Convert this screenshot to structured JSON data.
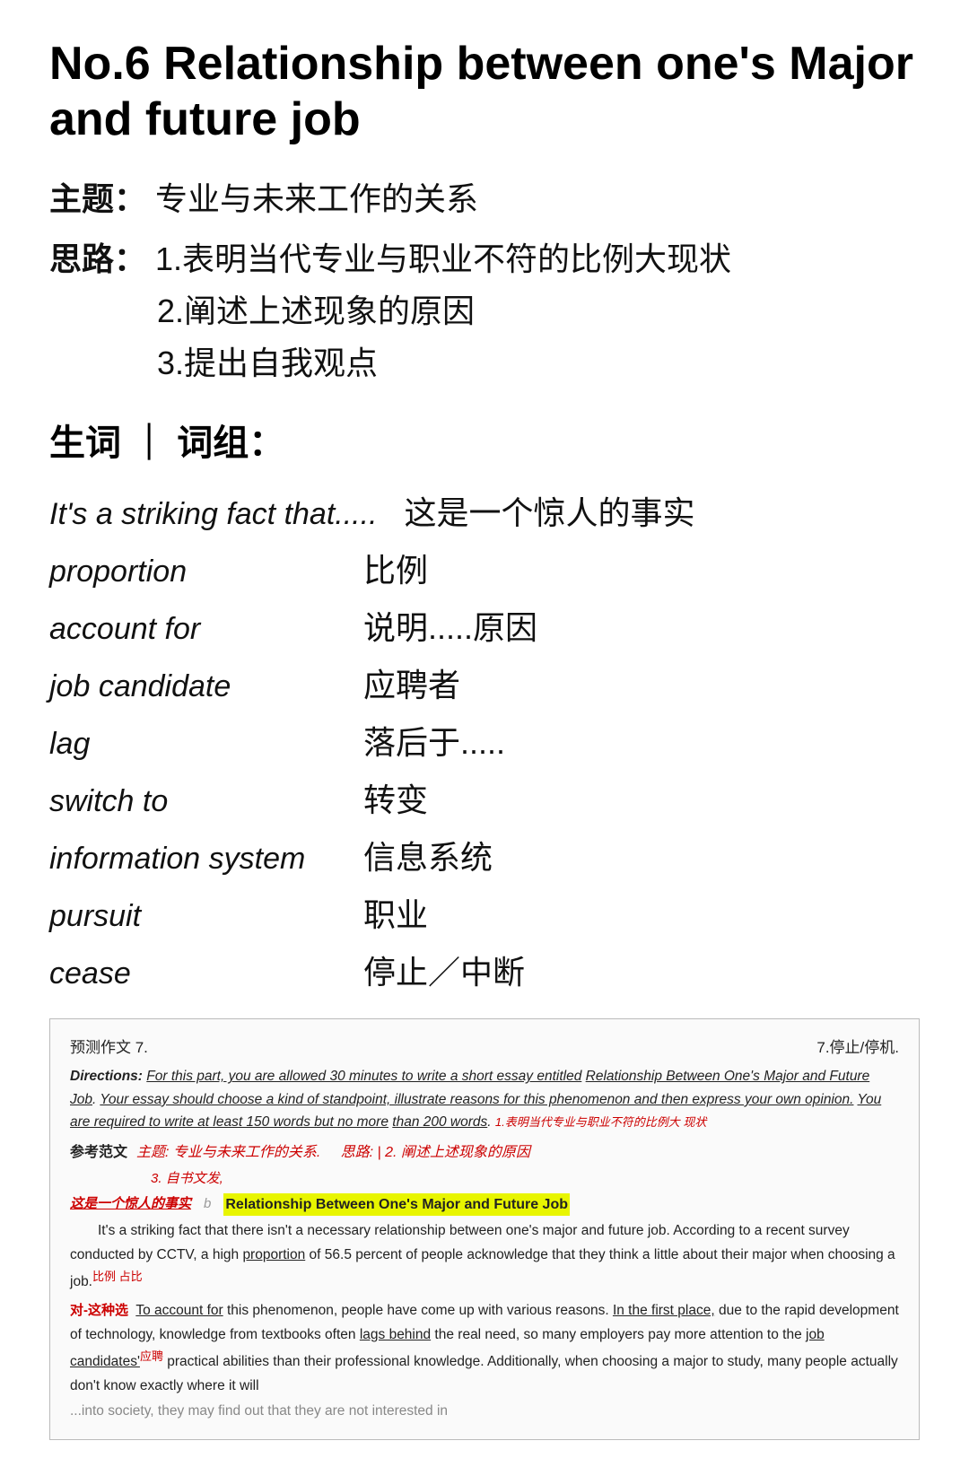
{
  "title": "No.6 Relationship between one's Major and future job",
  "meta": {
    "theme_label": "主题：",
    "theme_text": "专业与未来工作的关系",
    "approach_label": "思路：",
    "approach_items": [
      "1.表明当代专业与职业不符的比例大现状",
      "2.阐述上述现象的原因",
      "3.提出自我观点"
    ]
  },
  "vocab_header": "生词 ｜ 词组：",
  "vocab": [
    {
      "en": "It's a striking fact that.....",
      "zh": "这是一个惊人的事实"
    },
    {
      "en": "proportion",
      "zh": "比例"
    },
    {
      "en": "account for",
      "zh": "说明.....原因"
    },
    {
      "en": "job candidate",
      "zh": "应聘者"
    },
    {
      "en": "lag",
      "zh": "落后于....."
    },
    {
      "en": "switch to",
      "zh": "转变"
    },
    {
      "en": "information system",
      "zh": "信息系统"
    },
    {
      "en": "pursuit",
      "zh": "职业"
    },
    {
      "en": "cease",
      "zh": "停止／中断"
    }
  ],
  "document": {
    "header_left": "预测作文 7.",
    "header_right": "7.停止/停机.",
    "directions_label": "Directions:",
    "directions_text": "For this part, you are allowed 30 minutes to write a short essay entitled Relationship Between One's Major and Future Job. Your essay should choose a kind of standpoint, illustrate reasons for this phenomenon and then express your own opinion. You are required to write at least 150 words but no more than 200 words.",
    "ref_label": "参考范文",
    "ref_theme": "主题: 专业与未来工作的关系.",
    "ref_approach": "思路: 1.表明当代专业与职业不符的比例大现状",
    "ref_approach2": "2.阐述上述现象的原因",
    "ref_approach3": "3.自书文发",
    "striking_note": "这是一个惊人的事实",
    "essay_title": "Relationship Between One's Major and Future Job",
    "essay_p1": "It's a striking fact that there isn't a necessary relationship between one's major and future job. According to a recent survey conducted by CCTV, a high proportion of 56.5 percent of people acknowledge that they think a little about their major when choosing a job.",
    "annotation_p1": "比例 占比",
    "essay_p2": "To account for this phenomenon, people have come up with various reasons. In the first place, due to the rapid development of technology, knowledge from textbooks often lags behind the real need, so many employers pay more attention to the job candidates' practical abilities than their professional knowledge. Additionally, when choosing a major to study, many people actually don't know exactly where it will",
    "annotation_p2": "应聘",
    "para2_label": "对-这种选 To",
    "ellipsis": "...into society, they may find out that they are not interested in"
  }
}
